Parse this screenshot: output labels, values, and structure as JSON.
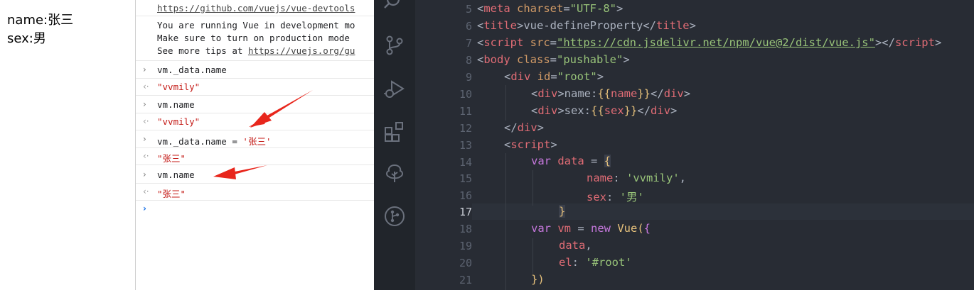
{
  "page": {
    "lines": [
      "name:张三",
      "sex:男"
    ]
  },
  "console": {
    "header_link": "https://github.com/vuejs/vue-devtools",
    "warn_line1": "You are running Vue in development mo",
    "warn_line2": "Make sure to turn on production mode",
    "warn_line3_prefix": "See more tips at ",
    "warn_line3_link": "https://vuejs.org/gu",
    "entries": [
      {
        "cmd": "vm._data.name",
        "result": "\"vvmily\""
      },
      {
        "cmd": "vm.name",
        "result": "\"vvmily\""
      },
      {
        "cmd_prefix": "vm._data.name = ",
        "cmd_string": "'张三'",
        "result": "\"张三\""
      },
      {
        "cmd": "vm.name",
        "result": "\"张三\""
      }
    ],
    "prompt_glyph": "›",
    "input_glyph": "›",
    "output_glyph": "‹·"
  },
  "editor": {
    "active_line": "17",
    "line_numbers": [
      "5",
      "6",
      "7",
      "8",
      "9",
      "10",
      "11",
      "12",
      "13",
      "14",
      "15",
      "16",
      "17",
      "18",
      "19",
      "20",
      "21"
    ],
    "code": {
      "l5": {
        "open": "<",
        "tag": "meta",
        "attr": " charset",
        "eq": "=",
        "val": "\"UTF-8\"",
        "close": ">"
      },
      "l6": {
        "open": "<",
        "tag": "title",
        "mid": ">vue-defineProperty</",
        "tag2": "title",
        "close": ">"
      },
      "l7": {
        "open": "<",
        "tag": "script",
        "attr": " src",
        "eq": "=",
        "val": "\"https://cdn.jsdelivr.net/npm/vue@2/dist/vue.js\"",
        "mid": "></",
        "tag2": "script",
        "close": ">"
      },
      "l8": {
        "open": "<",
        "tag": "body",
        "attr": " class",
        "eq": "=",
        "val": "\"pushable\"",
        "close": ">"
      },
      "l9": {
        "open": "<",
        "tag": "div",
        "attr": " id",
        "eq": "=",
        "val": "\"root\"",
        "close": ">"
      },
      "l10": {
        "open": "<",
        "tag": "div",
        "mid1": ">name:",
        "b1": "{{",
        "var": "name",
        "b2": "}}",
        "mid2": "</",
        "tag2": "div",
        "close": ">"
      },
      "l11": {
        "open": "<",
        "tag": "div",
        "mid1": ">sex:",
        "b1": "{{",
        "var": "sex",
        "b2": "}}",
        "mid2": "</",
        "tag2": "div",
        "close": ">"
      },
      "l12": {
        "open": "</",
        "tag": "div",
        "close": ">"
      },
      "l13": {
        "open": "<",
        "tag": "script",
        "close": ">"
      },
      "l14": {
        "kw": "var",
        "name": " data",
        "op": " = ",
        "br": "{"
      },
      "l15": {
        "key": "name",
        "colon": ": ",
        "val": "'vvmily'",
        "comma": ","
      },
      "l16": {
        "key": "sex",
        "colon": ": ",
        "val": "'男'"
      },
      "l17": {
        "br": "}"
      },
      "l18": {
        "kw": "var",
        "name": " vm",
        "op": " = ",
        "kw2": "new",
        "fn": " Vue",
        "p": "(",
        "br": "{"
      },
      "l19": {
        "key": "data",
        "comma": ","
      },
      "l20": {
        "key": "el",
        "colon": ": ",
        "val": "'#root'"
      },
      "l21": {
        "br": "})"
      }
    }
  },
  "colors": {
    "console_string": "#c41a16",
    "arrow": "#e8261c",
    "editor_bg": "#282c34"
  }
}
